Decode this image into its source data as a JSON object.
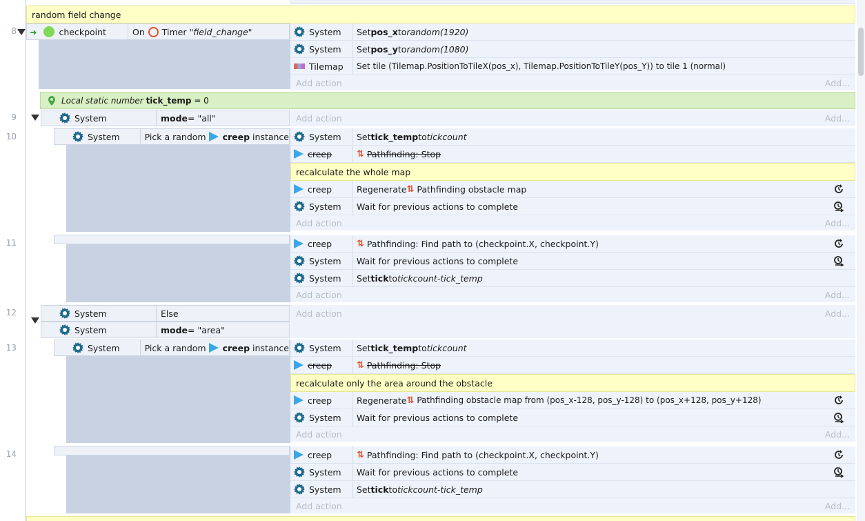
{
  "comments": {
    "random_field": "random field change",
    "whole_map": "recalculate the whole map",
    "area": "recalculate only the area around the obstacle"
  },
  "line_numbers": [
    "8",
    "9",
    "10",
    "11",
    "12",
    "13",
    "14"
  ],
  "add_action": "Add action",
  "add": "Add...",
  "event8": {
    "cond_object": "checkpoint",
    "cond_on": "On",
    "cond_timer": "Timer",
    "cond_timer_name": "\"field_change\"",
    "actions": [
      {
        "object": "System",
        "pre": "Set ",
        "bold": "pos_x",
        "mid": " to ",
        "ital": "random(1920)"
      },
      {
        "object": "System",
        "pre": "Set ",
        "bold": "pos_y",
        "mid": " to ",
        "ital": "random(1080)"
      },
      {
        "object": "Tilemap",
        "text": "Set tile (Tilemap.PositionToTileX(pos_x), Tilemap.PositionToTileY(pos_Y)) to tile 1 (normal)"
      }
    ]
  },
  "local_var": {
    "label": "Local static number",
    "name": "tick_temp",
    "value": "= 0"
  },
  "event9": {
    "object": "System",
    "bold": "mode",
    "value": " = \"all\""
  },
  "event10": {
    "object": "System",
    "pick": "Pick a random",
    "pick_obj": "creep",
    "pick_end": "instance",
    "actions": [
      {
        "object": "System",
        "pre": "Set ",
        "bold": "tick_temp",
        "mid": " to ",
        "ital": "tickcount"
      },
      {
        "object": "creep",
        "text": "Pathfinding: Stop"
      },
      {
        "object": "creep",
        "pre": "Regenerate ",
        "text": "Pathfinding obstacle map"
      },
      {
        "object": "System",
        "text": "Wait for previous actions to complete"
      }
    ]
  },
  "event11": {
    "actions": [
      {
        "object": "creep",
        "text": "Pathfinding: Find path to (checkpoint.X, checkpoint.Y)"
      },
      {
        "object": "System",
        "text": "Wait for previous actions to complete"
      },
      {
        "object": "System",
        "pre": "Set ",
        "bold": "tick",
        "mid": " to ",
        "ital": "tickcount-tick_temp"
      }
    ]
  },
  "event12": {
    "object": "System",
    "else": "Else",
    "object2": "System",
    "bold": "mode",
    "value": " = \"area\""
  },
  "event13": {
    "object": "System",
    "pick": "Pick a random",
    "pick_obj": "creep",
    "pick_end": "instance",
    "actions": [
      {
        "object": "System",
        "pre": "Set ",
        "bold": "tick_temp",
        "mid": " to ",
        "ital": "tickcount"
      },
      {
        "object": "creep",
        "text": "Pathfinding: Stop"
      },
      {
        "object": "creep",
        "pre": "Regenerate ",
        "text": "Pathfinding obstacle map from (pos_x-128, pos_y-128) to (pos_x+128, pos_y+128)"
      },
      {
        "object": "System",
        "text": "Wait for previous actions to complete"
      }
    ]
  },
  "event14": {
    "actions": [
      {
        "object": "creep",
        "text": "Pathfinding: Find path to (checkpoint.X, checkpoint.Y)"
      },
      {
        "object": "System",
        "text": "Wait for previous actions to complete"
      },
      {
        "object": "System",
        "pre": "Set ",
        "bold": "tick",
        "mid": " to ",
        "ital": "tickcount-tick_temp"
      }
    ]
  }
}
